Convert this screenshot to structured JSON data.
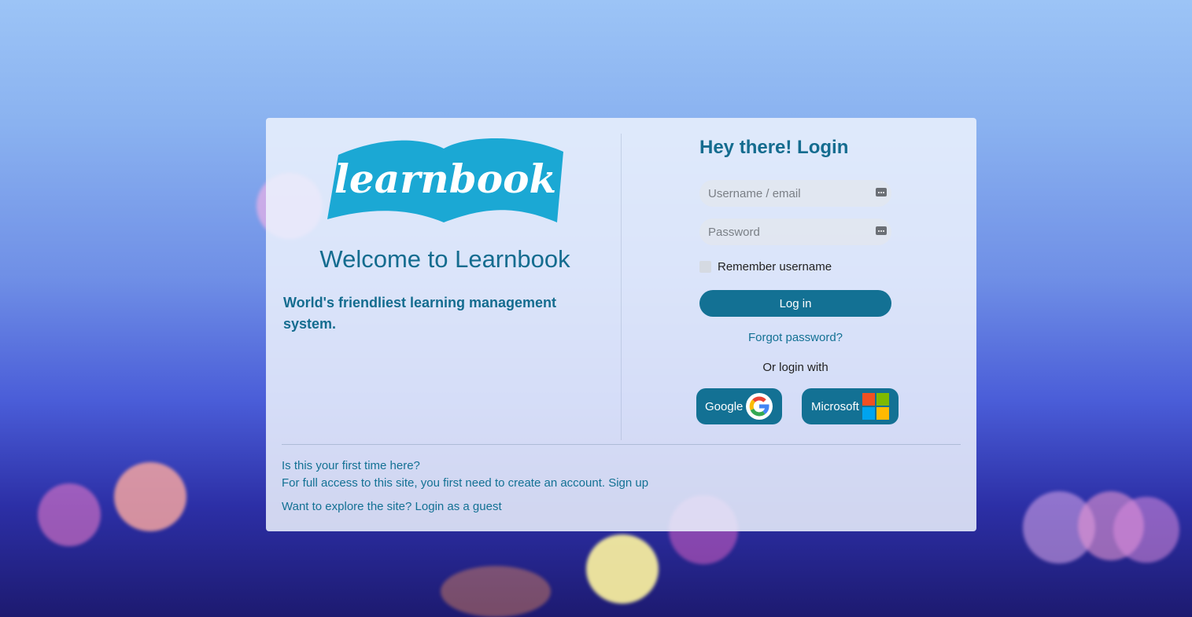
{
  "brand": {
    "logo_text": "learnbook",
    "welcome": "Welcome to Learnbook",
    "tagline": "World's friendliest learning management system.",
    "accent_color": "#137194",
    "logo_color": "#1ba8d4"
  },
  "login": {
    "title": "Hey there! Login",
    "username_placeholder": "Username / email",
    "password_placeholder": "Password",
    "remember_label": "Remember username",
    "login_button": "Log in",
    "forgot_link": "Forgot password?",
    "or_login_with": "Or login with",
    "sso": {
      "google_label": "Google",
      "google_icon": "google-g-icon",
      "microsoft_label": "Microsoft",
      "microsoft_icon": "microsoft-logo-icon"
    }
  },
  "footer": {
    "first_time": "Is this your first time here?",
    "create_account_text": "For full access to this site, you first need to create an account.",
    "signup_link": "Sign up",
    "explore_text": "Want to explore the site?",
    "guest_link": "Login as a guest"
  }
}
